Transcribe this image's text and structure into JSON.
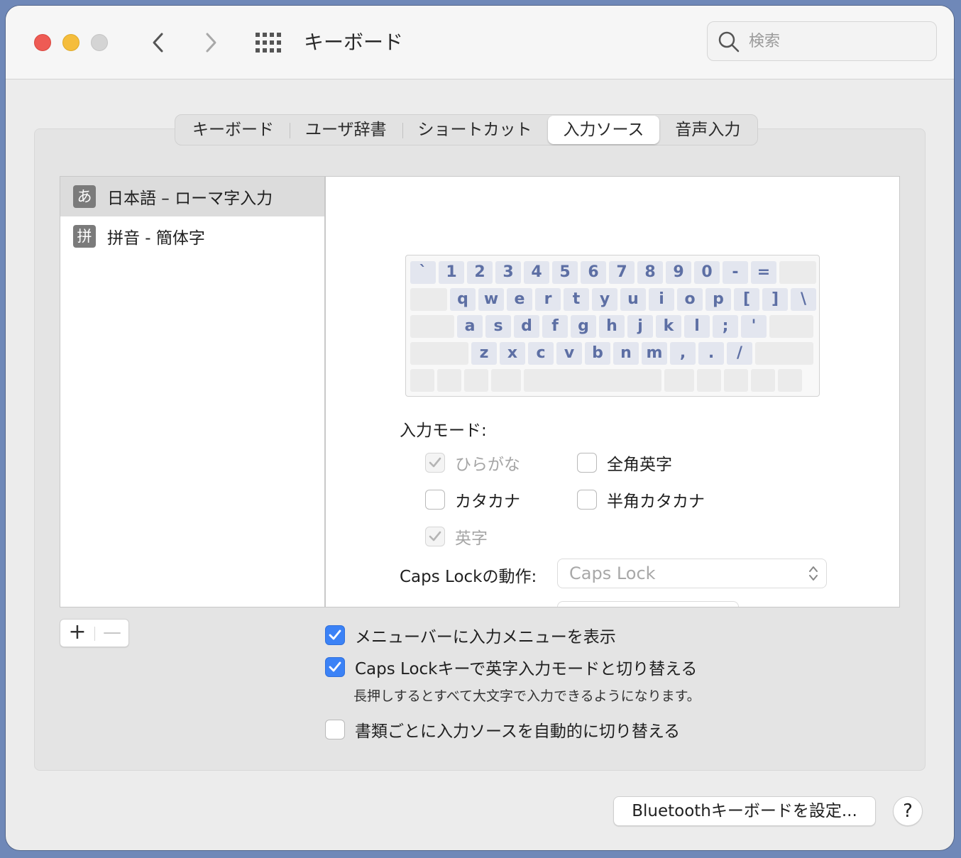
{
  "window": {
    "title": "キーボード"
  },
  "search": {
    "placeholder": "検索"
  },
  "tabs": [
    {
      "label": "キーボード",
      "active": false
    },
    {
      "label": "ユーザ辞書",
      "active": false
    },
    {
      "label": "ショートカット",
      "active": false
    },
    {
      "label": "入力ソース",
      "active": true
    },
    {
      "label": "音声入力",
      "active": false
    }
  ],
  "sources": [
    {
      "badge": "あ",
      "label": "日本語 – ローマ字入力",
      "selected": true
    },
    {
      "badge": "拼",
      "label": "拼音 - 簡体字",
      "selected": false
    }
  ],
  "keyboard": {
    "row1": [
      "`",
      "1",
      "2",
      "3",
      "4",
      "5",
      "6",
      "7",
      "8",
      "9",
      "0",
      "-",
      "="
    ],
    "row2": [
      "q",
      "w",
      "e",
      "r",
      "t",
      "y",
      "u",
      "i",
      "o",
      "p",
      "[",
      "]",
      "\\"
    ],
    "row3": [
      "a",
      "s",
      "d",
      "f",
      "g",
      "h",
      "j",
      "k",
      "l",
      ";",
      "'"
    ],
    "row4": [
      "z",
      "x",
      "c",
      "v",
      "b",
      "n",
      "m",
      ",",
      ".",
      "/"
    ]
  },
  "input_mode": {
    "label": "入力モード:",
    "options": {
      "hiragana": {
        "label": "ひらがな",
        "checked": true,
        "disabled": true
      },
      "fullwidth_roman": {
        "label": "全角英字",
        "checked": false,
        "disabled": false
      },
      "katakana": {
        "label": "カタカナ",
        "checked": false,
        "disabled": false
      },
      "halfwidth_katakana": {
        "label": "半角カタカナ",
        "checked": false,
        "disabled": false
      },
      "romaji": {
        "label": "英字",
        "checked": true,
        "disabled": true
      }
    }
  },
  "caps_lock": {
    "label": "Caps Lockの動作:",
    "value": "Caps Lock"
  },
  "options": {
    "show_menu": {
      "label": "メニューバーに入力メニューを表示",
      "checked": true
    },
    "caps_switch": {
      "label": "Caps Lockキーで英字入力モードと切り替える",
      "checked": true
    },
    "caps_note": "長押しするとすべて大文字で入力できるようになります。",
    "auto_switch": {
      "label": "書類ごとに入力ソースを自動的に切り替える",
      "checked": false
    }
  },
  "buttons": {
    "add": "+",
    "remove": "—",
    "bluetooth": "Bluetoothキーボードを設定...",
    "help": "?"
  },
  "colors": {
    "accent": "#3b82f6",
    "key_text": "#5d6fa4"
  }
}
